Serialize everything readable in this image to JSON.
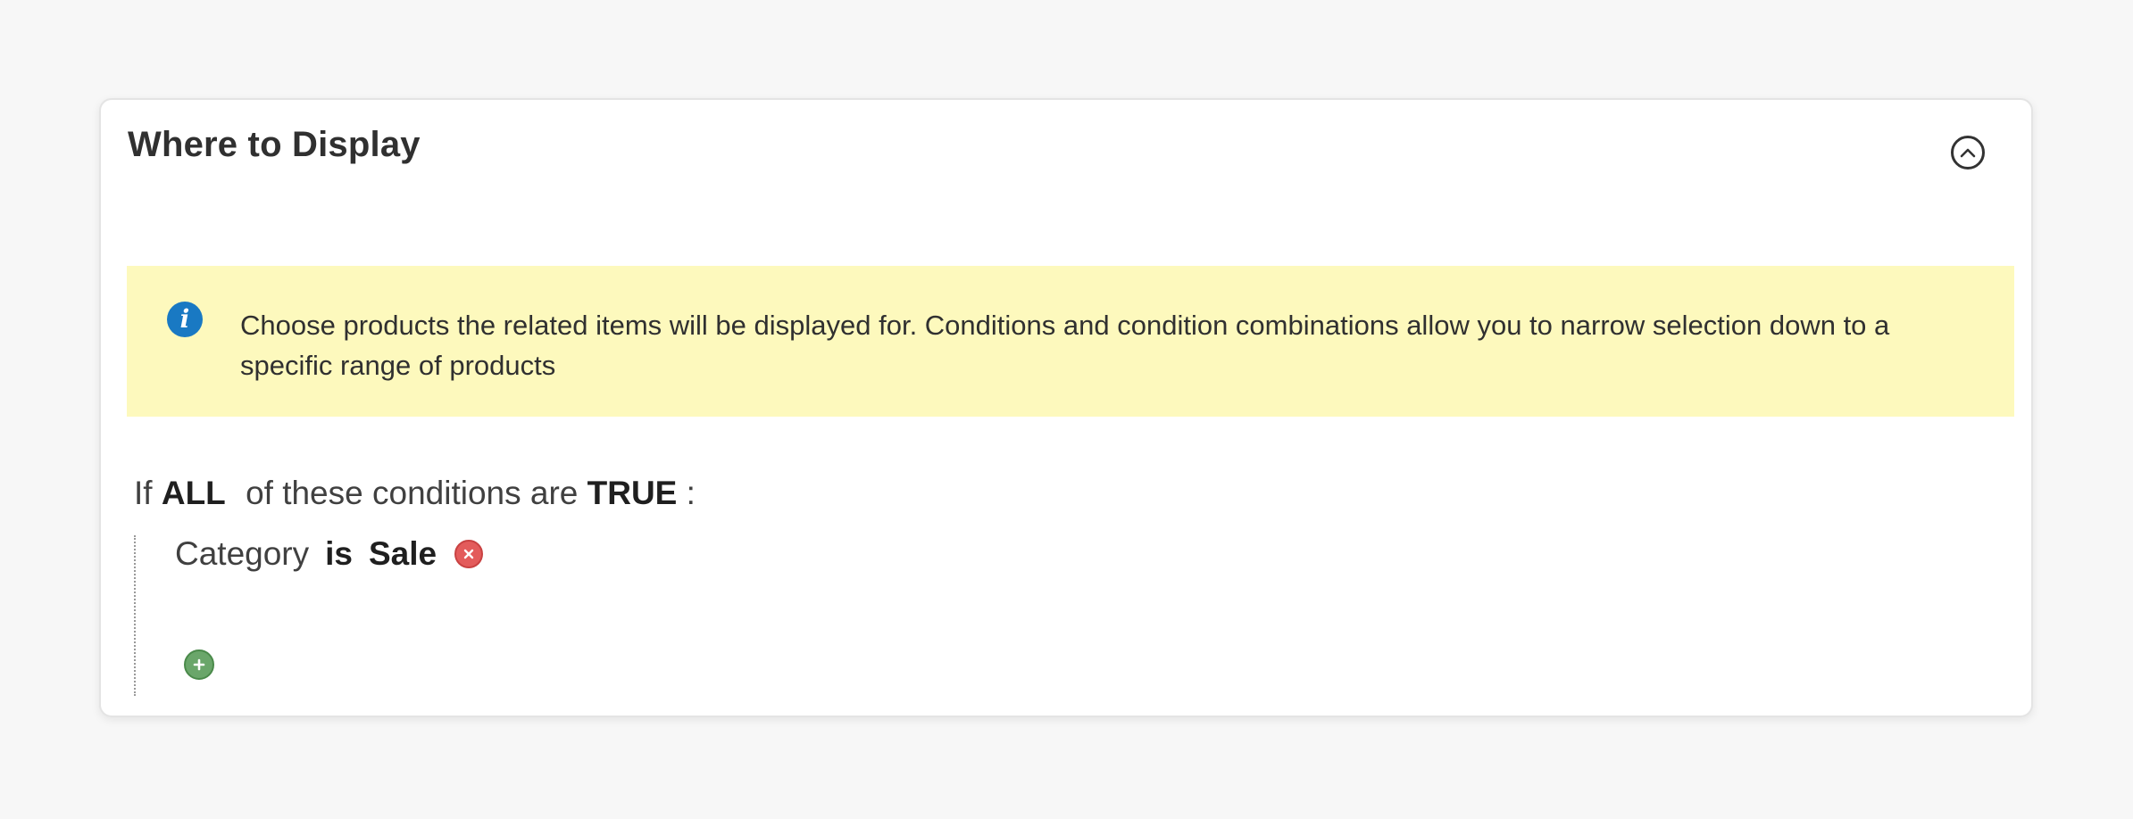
{
  "panel": {
    "title": "Where to Display",
    "collapse_icon": "chevron-up-circle-icon"
  },
  "notice": {
    "icon": "info-icon",
    "icon_glyph": "i",
    "text": "Choose products the related items will be displayed for. Conditions and condition combinations allow you to narrow selection down to a specific range of products",
    "background": "#fdf9bd"
  },
  "rule": {
    "prefix": "If",
    "aggregator": "ALL",
    "middle": "of these conditions are",
    "value": "TRUE",
    "suffix": ":",
    "conditions": [
      {
        "attribute": "Category",
        "operator": "is",
        "value": "Sale",
        "remove_icon": "remove-circle-icon"
      }
    ],
    "add_icon": "add-circle-icon"
  },
  "colors": {
    "info": "#1979c3",
    "remove": "#e35b5b",
    "add": "#6aa66a"
  }
}
